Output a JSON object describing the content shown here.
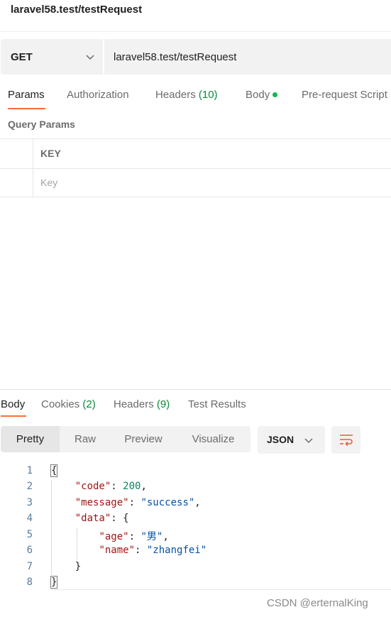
{
  "request": {
    "title": "laravel58.test/testRequest",
    "method": "GET",
    "url": "laravel58.test/testRequest"
  },
  "request_tabs": {
    "params": "Params",
    "authorization": "Authorization",
    "headers": "Headers",
    "headers_count": "(10)",
    "body": "Body",
    "pre_request": "Pre-request Script"
  },
  "query_params": {
    "title": "Query Params",
    "key_header": "KEY",
    "key_placeholder": "Key"
  },
  "response_tabs": {
    "body": "Body",
    "cookies": "Cookies",
    "cookies_count": "(2)",
    "headers": "Headers",
    "headers_count": "(9)",
    "test_results": "Test Results"
  },
  "view_modes": {
    "pretty": "Pretty",
    "raw": "Raw",
    "preview": "Preview",
    "visualize": "Visualize"
  },
  "format": "JSON",
  "code": {
    "line_numbers": [
      "1",
      "2",
      "3",
      "4",
      "5",
      "6",
      "7",
      "8"
    ],
    "open_brace": "{",
    "close_brace": "}",
    "code_key": "\"code\"",
    "code_value": "200",
    "message_key": "\"message\"",
    "message_value": "\"success\"",
    "data_key": "\"data\"",
    "age_key": "\"age\"",
    "age_value": "\"男\"",
    "name_key": "\"name\"",
    "name_value": "\"zhangfei\""
  },
  "watermark": "CSDN @erternalKing",
  "colors": {
    "accent": "#ff6c37",
    "count_green": "#0a8a3b",
    "json_key": "#a31515",
    "json_string": "#0451a5",
    "json_number": "#098658"
  },
  "icons": {
    "method_dropdown": "chevron-down-icon",
    "format_dropdown": "chevron-down-icon",
    "wrap": "wrap-lines-icon",
    "body_indicator": "dot-icon"
  }
}
